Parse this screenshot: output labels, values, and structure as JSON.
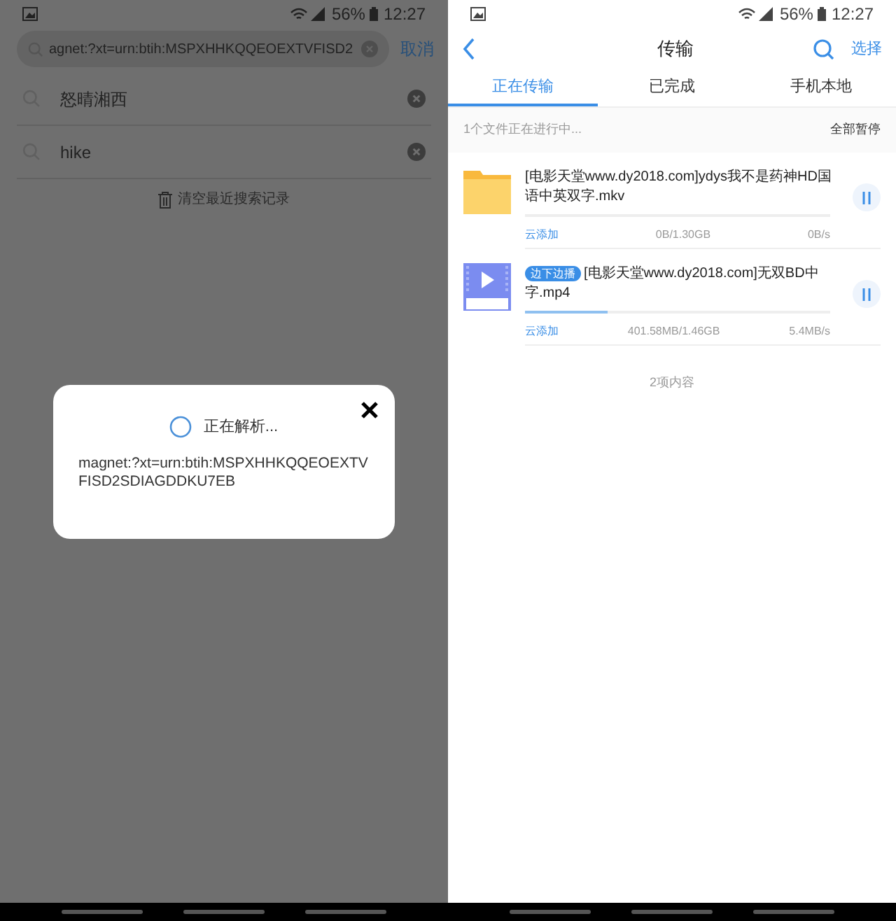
{
  "left_screen": {
    "status_bar": {
      "battery": "56%",
      "time": "12:27"
    },
    "search": {
      "value": "agnet:?xt=urn:btih:MSPXHHKQQEOEXTVFISD2",
      "cancel": "取消"
    },
    "history": [
      {
        "text": "怒晴湘西"
      },
      {
        "text": "hike"
      }
    ],
    "clear_history": "清空最近搜索记录",
    "dialog": {
      "status": "正在解析...",
      "link": "magnet:?xt=urn:btih:MSPXHHKQQEOEXTVFISD2SDIAGDDKU7EB"
    }
  },
  "right_screen": {
    "status_bar": {
      "battery": "56%",
      "time": "12:27"
    },
    "header": {
      "title": "传输",
      "action": "选择"
    },
    "tabs": [
      {
        "label": "正在传输",
        "selected": true
      },
      {
        "label": "已完成",
        "selected": false
      },
      {
        "label": "手机本地",
        "selected": false
      }
    ],
    "summary": "1个文件正在进行中...",
    "pause_all": "全部暂停",
    "transfers": [
      {
        "kind": "folder",
        "name": "[电影天堂www.dy2018.com]ydys我不是药神HD国语中英双字.mkv",
        "source": "云添加",
        "size": "0B/1.30GB",
        "speed": "0B/s"
      },
      {
        "kind": "video",
        "badge": "边下边播",
        "name": "[电影天堂www.dy2018.com]无双BD中字.mp4",
        "source": "云添加",
        "size": "401.58MB/1.46GB",
        "speed": "5.4MB/s",
        "level": 0.27
      }
    ],
    "footer": "2项内容"
  }
}
